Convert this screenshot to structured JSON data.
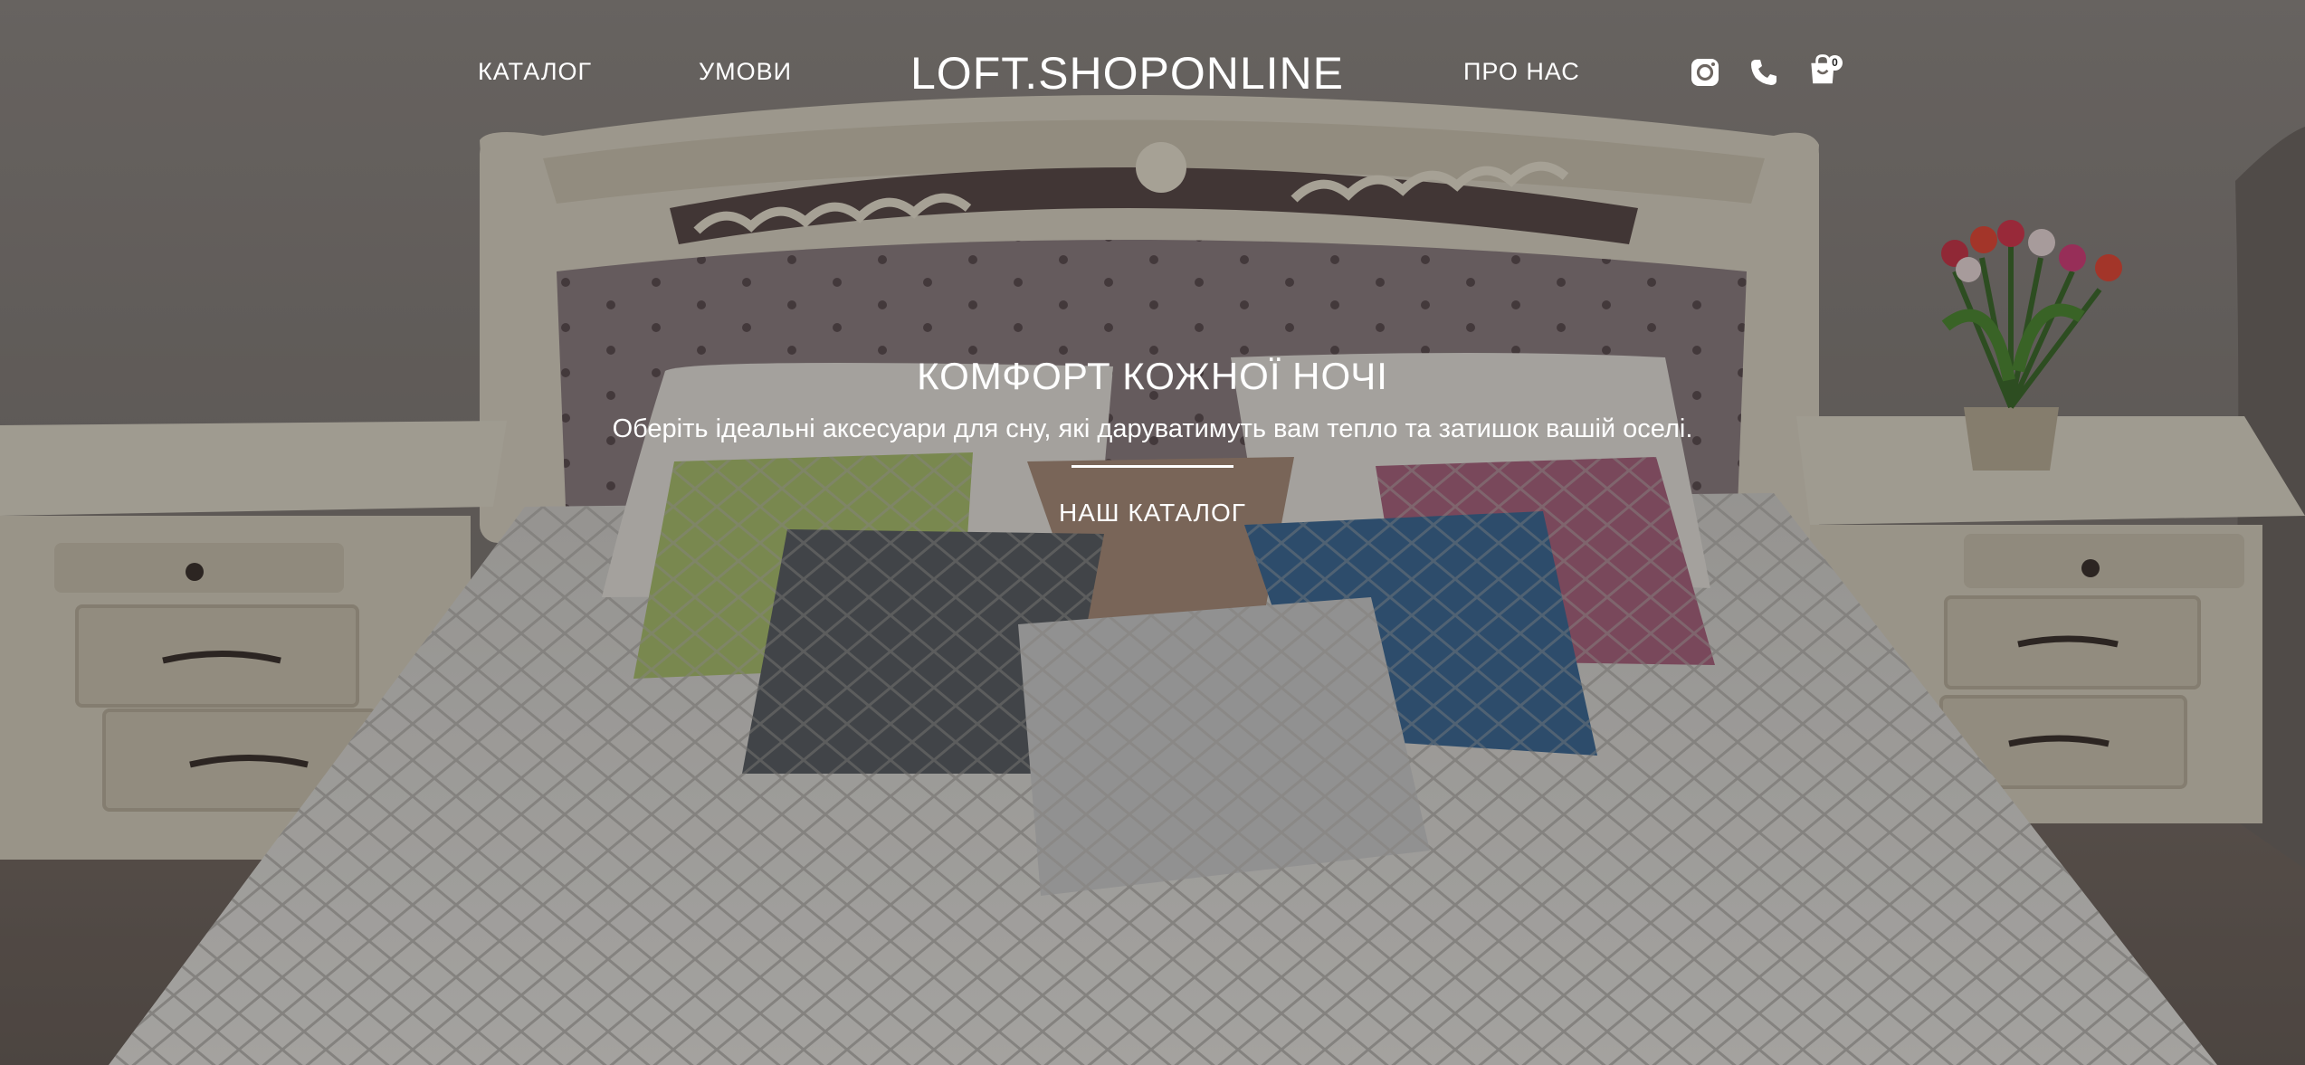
{
  "header": {
    "logo": "LOFT.SHOPONLINE",
    "nav": {
      "catalog": "КАТАЛОГ",
      "terms": "УМОВИ",
      "about": "ПРО НАС"
    },
    "icons": {
      "instagram": "instagram-icon",
      "phone": "phone-icon",
      "cart": "shopping-bag-icon"
    },
    "cart_count": "0"
  },
  "hero": {
    "title": "КОМФОРТ КОЖНОЇ НОЧІ",
    "subtitle": "Оберіть ідеальні аксесуари для сну, які даруватимуть вам тепло та затишок вашій оселі.",
    "cta": "НАШ КАТАЛОГ"
  },
  "colors": {
    "text": "#ffffff",
    "wall": "#8a8480",
    "bed": "#d8d6d2"
  }
}
